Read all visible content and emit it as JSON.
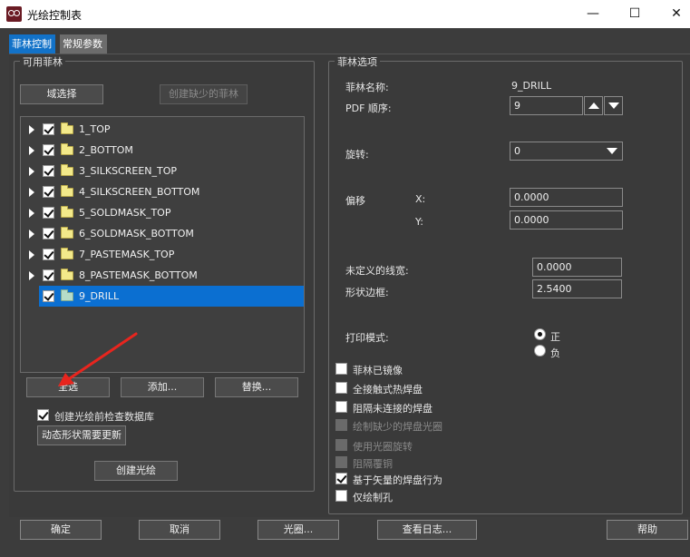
{
  "window": {
    "title": "光绘控制表",
    "minimize": "—",
    "maximize": "☐",
    "close": "✕"
  },
  "tabs": [
    {
      "label": "菲林控制",
      "active": true
    },
    {
      "label": "常规参数",
      "active": false
    }
  ],
  "left_group": {
    "title": "可用菲林",
    "domain_select_button": "域选择",
    "create_missing_button": "创建缺少的菲林",
    "films": [
      {
        "label": "1_TOP",
        "checked": true
      },
      {
        "label": "2_BOTTOM",
        "checked": true
      },
      {
        "label": "3_SILKSCREEN_TOP",
        "checked": true
      },
      {
        "label": "4_SILKSCREEN_BOTTOM",
        "checked": true
      },
      {
        "label": "5_SOLDMASK_TOP",
        "checked": true
      },
      {
        "label": "6_SOLDMASK_BOTTOM",
        "checked": true
      },
      {
        "label": "7_PASTEMASK_TOP",
        "checked": true
      },
      {
        "label": "8_PASTEMASK_BOTTOM",
        "checked": true
      },
      {
        "label": "9_DRILL",
        "checked": true,
        "selected": true
      }
    ],
    "select_all_button": "全选",
    "add_button": "添加...",
    "replace_button": "替换...",
    "check_db_label": "创建光绘前检查数据库",
    "check_db_checked": true,
    "dynamic_update_button": "动态形状需要更新",
    "create_artwork_button": "创建光绘"
  },
  "right_group": {
    "title": "菲林选项",
    "film_name_label": "菲林名称:",
    "film_name_value": "9_DRILL",
    "pdf_order_label": "PDF 顺序:",
    "pdf_order_value": "9",
    "rotation_label": "旋转:",
    "rotation_value": "0",
    "offset_label": "偏移",
    "x_label": "X:",
    "x_value": "0.0000",
    "y_label": "Y:",
    "y_value": "0.0000",
    "undefined_width_label": "未定义的线宽:",
    "undefined_width_value": "0.0000",
    "shape_border_label": "形状边框:",
    "shape_border_value": "2.5400",
    "print_mode_label": "打印模式:",
    "print_mode_positive": "正",
    "print_mode_negative": "负",
    "options": [
      {
        "label": "菲林已镜像",
        "checked": false,
        "enabled": true
      },
      {
        "label": "全接触式热焊盘",
        "checked": false,
        "enabled": true
      },
      {
        "label": "阻隔未连接的焊盘",
        "checked": false,
        "enabled": true
      },
      {
        "label": "绘制缺少的焊盘光圈",
        "checked": false,
        "enabled": false
      },
      {
        "label": "使用光圈旋转",
        "checked": false,
        "enabled": false
      },
      {
        "label": "阻隔覆铜",
        "checked": false,
        "enabled": false
      },
      {
        "label": "基于矢量的焊盘行为",
        "checked": true,
        "enabled": true
      },
      {
        "label": "仅绘制孔",
        "checked": false,
        "enabled": true
      }
    ]
  },
  "bottom_bar": {
    "ok": "确定",
    "cancel": "取消",
    "aperture": "光圈...",
    "view_log": "查看日志...",
    "help": "帮助"
  },
  "colors": {
    "accent": "#1272c8",
    "selection": "#0b6fd1",
    "annotation_arrow": "#e8251e"
  }
}
